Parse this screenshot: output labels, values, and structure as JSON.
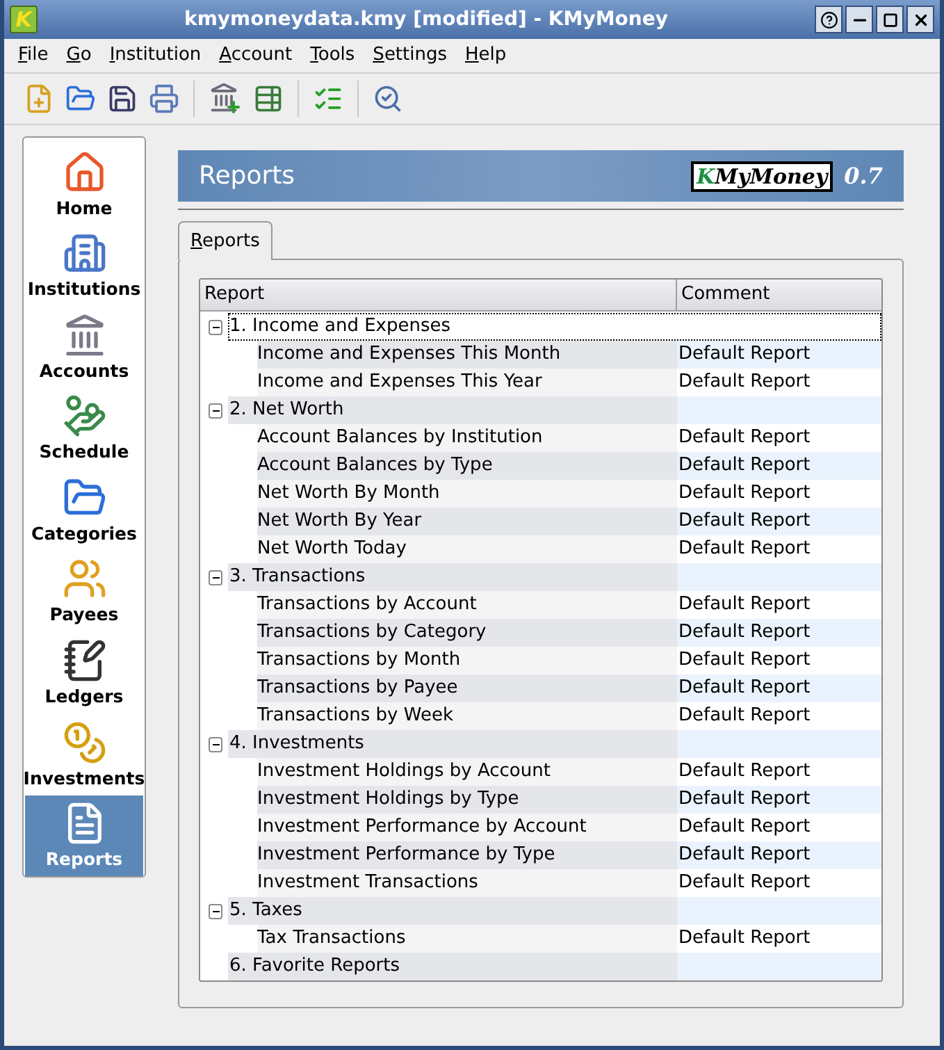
{
  "window": {
    "logo": "K",
    "title": "kmymoneydata.kmy [modified] - KMyMoney"
  },
  "menu": [
    "File",
    "Go",
    "Institution",
    "Account",
    "Tools",
    "Settings",
    "Help"
  ],
  "sidebar": {
    "items": [
      {
        "label": "Home",
        "selected": false
      },
      {
        "label": "Institutions",
        "selected": false
      },
      {
        "label": "Accounts",
        "selected": false
      },
      {
        "label": "Schedule",
        "selected": false
      },
      {
        "label": "Categories",
        "selected": false
      },
      {
        "label": "Payees",
        "selected": false
      },
      {
        "label": "Ledgers",
        "selected": false
      },
      {
        "label": "Investments",
        "selected": false
      },
      {
        "label": "Reports",
        "selected": true
      }
    ]
  },
  "banner": {
    "title": "Reports",
    "logo": "KMyMoney",
    "version": "0.7"
  },
  "tabs": [
    {
      "label": "Reports",
      "selected": true
    }
  ],
  "table": {
    "columns": [
      "Report",
      "Comment"
    ],
    "rows": [
      {
        "label": "1. Income and Expenses",
        "expanded": true,
        "focused": true,
        "children": [
          {
            "label": "Income and Expenses This Month",
            "comment": "Default Report"
          },
          {
            "label": "Income and Expenses This Year",
            "comment": "Default Report"
          }
        ]
      },
      {
        "label": "2. Net Worth",
        "expanded": true,
        "focused": false,
        "children": [
          {
            "label": "Account Balances by Institution",
            "comment": "Default Report"
          },
          {
            "label": "Account Balances by Type",
            "comment": "Default Report"
          },
          {
            "label": "Net Worth By Month",
            "comment": "Default Report"
          },
          {
            "label": "Net Worth By Year",
            "comment": "Default Report"
          },
          {
            "label": "Net Worth Today",
            "comment": "Default Report"
          }
        ]
      },
      {
        "label": "3. Transactions",
        "expanded": true,
        "focused": false,
        "children": [
          {
            "label": "Transactions by Account",
            "comment": "Default Report"
          },
          {
            "label": "Transactions by Category",
            "comment": "Default Report"
          },
          {
            "label": "Transactions by Month",
            "comment": "Default Report"
          },
          {
            "label": "Transactions by Payee",
            "comment": "Default Report"
          },
          {
            "label": "Transactions by Week",
            "comment": "Default Report"
          }
        ]
      },
      {
        "label": "4. Investments",
        "expanded": true,
        "focused": false,
        "children": [
          {
            "label": "Investment Holdings by Account",
            "comment": "Default Report"
          },
          {
            "label": "Investment Holdings by Type",
            "comment": "Default Report"
          },
          {
            "label": "Investment Performance by Account",
            "comment": "Default Report"
          },
          {
            "label": "Investment Performance by Type",
            "comment": "Default Report"
          },
          {
            "label": "Investment Transactions",
            "comment": "Default Report"
          }
        ]
      },
      {
        "label": "5. Taxes",
        "expanded": true,
        "focused": false,
        "children": [
          {
            "label": "Tax Transactions",
            "comment": "Default Report"
          }
        ]
      },
      {
        "label": "6. Favorite Reports",
        "focused": false
      }
    ]
  }
}
